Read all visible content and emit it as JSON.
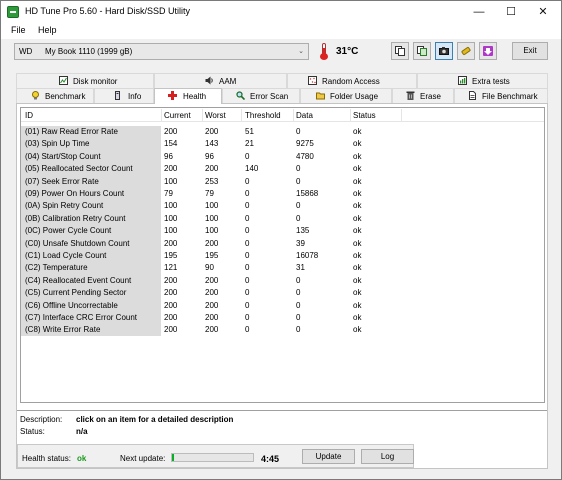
{
  "window": {
    "title": "HD Tune Pro 5.60 - Hard Disk/SSD Utility"
  },
  "menu": {
    "file": "File",
    "help": "Help"
  },
  "toolbar": {
    "drive_brand": "WD",
    "drive_name": "My Book 1110 (1999 gB)",
    "temperature": "31°C",
    "exit_label": "Exit",
    "buttons": [
      "copy-info-icon",
      "copy-screenshot-icon",
      "screenshot-icon",
      "options-icon",
      "download-icon"
    ]
  },
  "tabs_top": [
    {
      "label": "Disk monitor",
      "icon": "disk-monitor-icon"
    },
    {
      "label": "AAM",
      "icon": "speaker-icon"
    },
    {
      "label": "Random Access",
      "icon": "random-access-icon"
    },
    {
      "label": "Extra tests",
      "icon": "extra-tests-icon"
    }
  ],
  "tabs_bottom": [
    {
      "label": "Benchmark",
      "icon": "lightbulb-icon"
    },
    {
      "label": "Info",
      "icon": "info-icon"
    },
    {
      "label": "Health",
      "icon": "health-cross-icon",
      "selected": true
    },
    {
      "label": "Error Scan",
      "icon": "magnifier-icon"
    },
    {
      "label": "Folder Usage",
      "icon": "folder-icon"
    },
    {
      "label": "Erase",
      "icon": "trash-icon"
    },
    {
      "label": "File Benchmark",
      "icon": "file-icon"
    }
  ],
  "columns": [
    "ID",
    "Current",
    "Worst",
    "Threshold",
    "Data",
    "Status"
  ],
  "rows": [
    [
      "(01) Raw Read Error Rate",
      "200",
      "200",
      "51",
      "0",
      "ok"
    ],
    [
      "(03) Spin Up Time",
      "154",
      "143",
      "21",
      "9275",
      "ok"
    ],
    [
      "(04) Start/Stop Count",
      "96",
      "96",
      "0",
      "4780",
      "ok"
    ],
    [
      "(05) Reallocated Sector Count",
      "200",
      "200",
      "140",
      "0",
      "ok"
    ],
    [
      "(07) Seek Error Rate",
      "100",
      "253",
      "0",
      "0",
      "ok"
    ],
    [
      "(09) Power On Hours Count",
      "79",
      "79",
      "0",
      "15868",
      "ok"
    ],
    [
      "(0A) Spin Retry Count",
      "100",
      "100",
      "0",
      "0",
      "ok"
    ],
    [
      "(0B) Calibration Retry Count",
      "100",
      "100",
      "0",
      "0",
      "ok"
    ],
    [
      "(0C) Power Cycle Count",
      "100",
      "100",
      "0",
      "135",
      "ok"
    ],
    [
      "(C0) Unsafe Shutdown Count",
      "200",
      "200",
      "0",
      "39",
      "ok"
    ],
    [
      "(C1) Load Cycle Count",
      "195",
      "195",
      "0",
      "16078",
      "ok"
    ],
    [
      "(C2) Temperature",
      "121",
      "90",
      "0",
      "31",
      "ok"
    ],
    [
      "(C4) Reallocated Event Count",
      "200",
      "200",
      "0",
      "0",
      "ok"
    ],
    [
      "(C5) Current Pending Sector",
      "200",
      "200",
      "0",
      "0",
      "ok"
    ],
    [
      "(C6) Offline Uncorrectable",
      "200",
      "200",
      "0",
      "0",
      "ok"
    ],
    [
      "(C7) Interface CRC Error Count",
      "200",
      "200",
      "0",
      "0",
      "ok"
    ],
    [
      "(C8) Write Error Rate",
      "200",
      "200",
      "0",
      "0",
      "ok"
    ]
  ],
  "description": {
    "desc_label": "Description:",
    "desc_value": "click on an item for a detailed description",
    "status_label": "Status:",
    "status_value": "n/a"
  },
  "status_bar": {
    "health_label": "Health status:",
    "health_value": "ok",
    "next_update_label": "Next update:",
    "next_update_value": "4:45",
    "progress_fraction": 0.03,
    "update_label": "Update",
    "log_label": "Log"
  },
  "colors": {
    "health_ok": "#1a9a1a",
    "progress": "#06b025",
    "id_column_bg": "#dcdcdc"
  }
}
